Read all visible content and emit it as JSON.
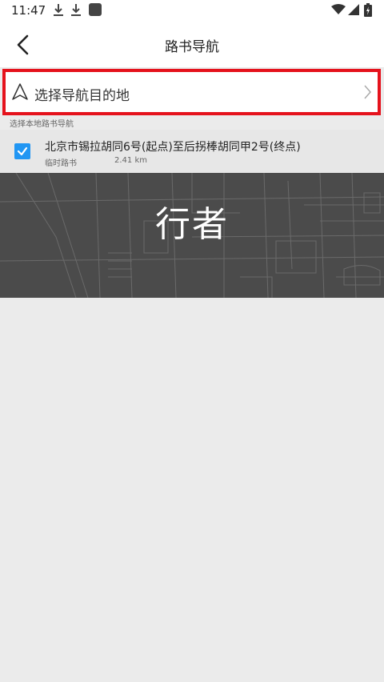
{
  "status_bar": {
    "time": "11:47",
    "icons": [
      "download-icon",
      "download-icon",
      "app-notification-icon",
      "wifi-icon",
      "signal-icon",
      "battery-icon"
    ]
  },
  "header": {
    "title": "路书导航",
    "back_icon": "chevron-left-icon"
  },
  "destination": {
    "label": "选择导航目的地",
    "icon": "navigation-arrow-icon",
    "chevron": "chevron-right-icon",
    "highlight_color": "#e5121c"
  },
  "section": {
    "caption": "选择本地路书导航"
  },
  "routes": [
    {
      "title": "北京市锡拉胡同6号(起点)至后拐棒胡同甲2号(终点)",
      "type": "临时路书",
      "distance": "2.41 km",
      "checked": true
    }
  ],
  "banner": {
    "logo_text": "行者"
  },
  "colors": {
    "accent": "#2196f3",
    "map_background": "#4b4b4b",
    "page_background": "#ebebeb"
  }
}
